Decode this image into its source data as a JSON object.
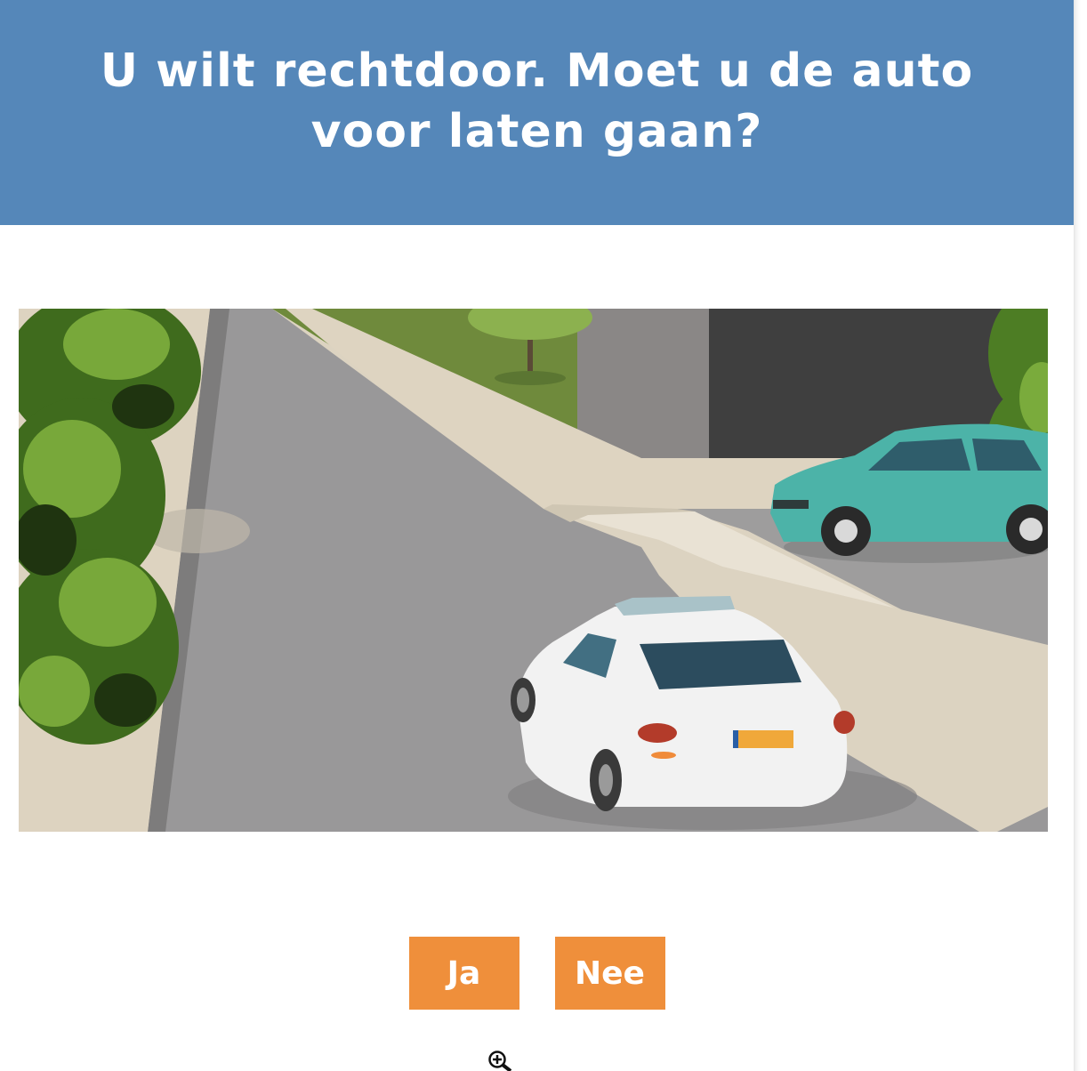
{
  "question": {
    "title": "U wilt rechtdoor. Moet u de auto voor laten gaan?"
  },
  "answers": [
    {
      "label": "Ja"
    },
    {
      "label": "Nee"
    }
  ],
  "colors": {
    "header_background": "#5587b9",
    "button_background": "#ef8f3b",
    "button_text": "#ffffff"
  },
  "icons": {
    "cursor": "zoom-in-icon"
  }
}
